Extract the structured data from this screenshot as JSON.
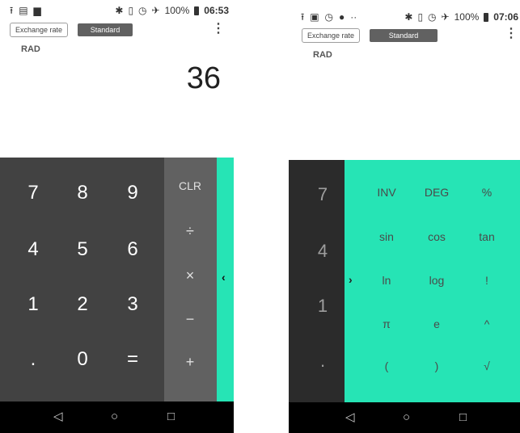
{
  "left": {
    "status": {
      "battery": "100%",
      "time": "06:53"
    },
    "mode": {
      "exchange": "Exchange rate",
      "standard": "Standard"
    },
    "menu_icon": "⋮",
    "angle_mode": "RAD",
    "display": "36",
    "keys": {
      "k7": "7",
      "k8": "8",
      "k9": "9",
      "k4": "4",
      "k5": "5",
      "k6": "6",
      "k1": "1",
      "k2": "2",
      "k3": "3",
      "dot": ".",
      "k0": "0",
      "eq": "="
    },
    "ops": {
      "clr": "CLR",
      "div": "÷",
      "mul": "×",
      "sub": "−",
      "add": "+"
    }
  },
  "right": {
    "status": {
      "battery": "100%",
      "time": "07:06"
    },
    "mode": {
      "exchange": "Exchange rate",
      "standard": "Standard"
    },
    "menu_icon": "⋮",
    "angle_mode": "RAD",
    "numkeys": {
      "k7": "7",
      "k4": "4",
      "k1": "1",
      "dot": "."
    },
    "adv": {
      "inv": "INV",
      "deg": "DEG",
      "pct": "%",
      "sin": "sin",
      "cos": "cos",
      "tan": "tan",
      "ln": "ln",
      "log": "log",
      "fact": "!",
      "pi": "π",
      "e": "e",
      "pow": "^",
      "lparen": "(",
      "rparen": ")",
      "sqrt": "√"
    }
  },
  "colors": {
    "accent": "#26e4b5",
    "numpad": "#424242",
    "oppad": "#616161"
  }
}
